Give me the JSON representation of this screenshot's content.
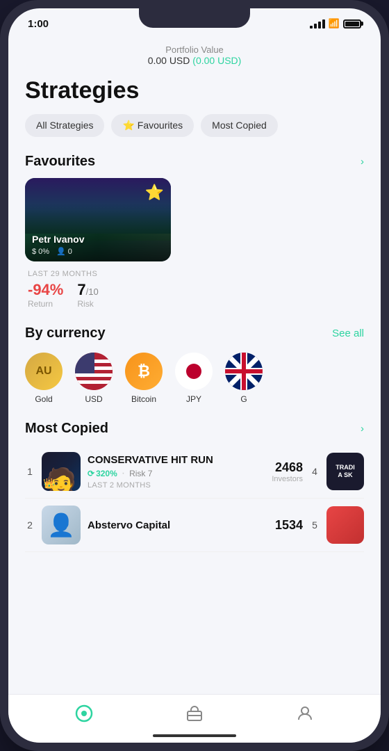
{
  "status_bar": {
    "time": "1:00",
    "location_icon": "↗"
  },
  "portfolio": {
    "label": "Portfolio Value",
    "value": "0.00 USD",
    "change": "(0.00 USD)"
  },
  "page": {
    "title": "Strategies"
  },
  "filter_tabs": [
    {
      "id": "all",
      "label": "All Strategies",
      "active": false
    },
    {
      "id": "favourites",
      "label": "⭐ Favourites",
      "active": false
    },
    {
      "id": "most_copied",
      "label": "Most Copied",
      "active": false
    }
  ],
  "favourites_section": {
    "title": "Favourites",
    "link": "›",
    "card": {
      "name": "Petr Ivanov",
      "return_pct": "0%",
      "copiers": "0",
      "star": "⭐",
      "duration_label": "LAST 29 MONTHS",
      "return_value": "-94%",
      "return_label": "Return",
      "risk_value": "7",
      "risk_max": "/10",
      "risk_label": "Risk"
    }
  },
  "currency_section": {
    "title": "By currency",
    "link": "See all",
    "items": [
      {
        "id": "gold",
        "symbol": "AU",
        "label": "Gold"
      },
      {
        "id": "usd",
        "symbol": "🇺🇸",
        "label": "USD"
      },
      {
        "id": "btc",
        "symbol": "₿",
        "label": "Bitcoin"
      },
      {
        "id": "jpy",
        "symbol": "JP",
        "label": "JPY"
      },
      {
        "id": "gbp",
        "symbol": "🇬🇧",
        "label": "G"
      }
    ]
  },
  "most_copied_section": {
    "title": "Most Copied",
    "link": "›",
    "items": [
      {
        "rank": "1",
        "name": "CONSERVATIVE HIT RUN",
        "return_pct": "320%",
        "risk": "Risk 7",
        "duration": "LAST 2 MONTHS",
        "investors_count": "2468",
        "investors_label": "Investors",
        "rank_right": "4",
        "has_crown": true
      },
      {
        "rank": "2",
        "name": "Abstervo Capital",
        "return_pct": "",
        "risk": "",
        "duration": "",
        "investors_count": "1534",
        "investors_label": "",
        "rank_right": "5",
        "has_crown": false
      }
    ]
  },
  "bottom_nav": {
    "items": [
      {
        "id": "strategies",
        "icon": "⊙",
        "active": true
      },
      {
        "id": "portfolio",
        "icon": "💼",
        "active": false
      },
      {
        "id": "profile",
        "icon": "👤",
        "active": false
      }
    ]
  }
}
